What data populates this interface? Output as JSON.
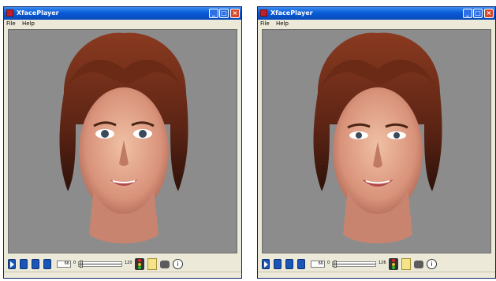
{
  "windows": [
    {
      "title": "XfacePlayer",
      "menu": [
        "File",
        "Help"
      ],
      "frame_field": "66",
      "slider_start": "0",
      "slider_end": "120",
      "slider_position": 0.02
    },
    {
      "title": "XfacePlayer",
      "menu": [
        "File",
        "Help"
      ],
      "frame_field": "66",
      "slider_start": "0",
      "slider_end": "126",
      "slider_position": 0.02
    }
  ],
  "window_buttons": {
    "minimize": "_",
    "maximize": "□",
    "close": "×"
  },
  "info_glyph": "i",
  "icons": [
    "play-icon",
    "stop-icon",
    "record-icon",
    "save-icon",
    "traffic-light-icon",
    "tool-icon",
    "camera-icon",
    "info-icon"
  ],
  "colors": {
    "titlebar": "#0a5bd8",
    "viewport": "#8c8c8c",
    "window": "#ece9d8",
    "close": "#d8482a"
  }
}
